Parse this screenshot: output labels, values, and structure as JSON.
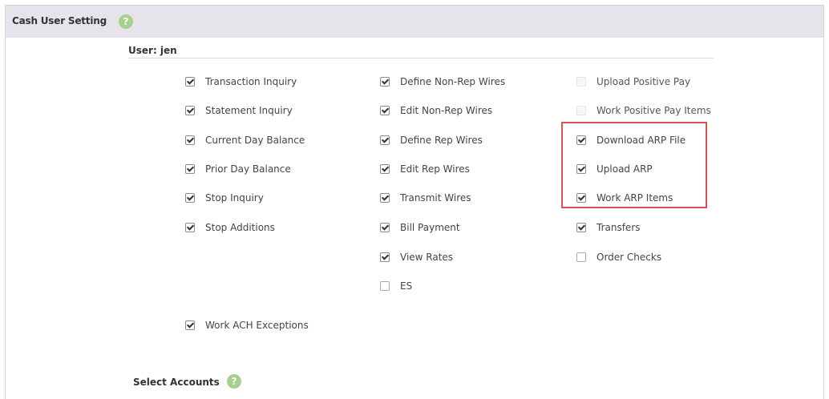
{
  "header": {
    "title": "Cash User Setting",
    "help_icon": "?"
  },
  "user": {
    "label": "User: jen"
  },
  "columns": [
    {
      "items": [
        {
          "label": "Transaction Inquiry",
          "checked": true
        },
        {
          "label": "Statement Inquiry",
          "checked": true
        },
        {
          "label": "Current Day Balance",
          "checked": true
        },
        {
          "label": "Prior Day Balance",
          "checked": true
        },
        {
          "label": "Stop Inquiry",
          "checked": true
        },
        {
          "label": "Stop Additions",
          "checked": true
        },
        {
          "label": "Work ACH Exceptions",
          "checked": true
        }
      ]
    },
    {
      "items": [
        {
          "label": "Define Non-Rep Wires",
          "checked": true
        },
        {
          "label": "Edit Non-Rep Wires",
          "checked": true
        },
        {
          "label": "Define Rep Wires",
          "checked": true
        },
        {
          "label": "Edit Rep Wires",
          "checked": true
        },
        {
          "label": "Transmit Wires",
          "checked": true
        },
        {
          "label": "Bill Payment",
          "checked": true
        },
        {
          "label": "View Rates",
          "checked": true
        },
        {
          "label": "ES",
          "checked": false
        }
      ]
    },
    {
      "items": [
        {
          "label": "Upload Positive Pay",
          "checked": false,
          "disabled": true
        },
        {
          "label": "Work Positive Pay Items",
          "checked": false,
          "disabled": true
        },
        {
          "label": "Download ARP File",
          "checked": true
        },
        {
          "label": "Upload ARP",
          "checked": true
        },
        {
          "label": "Work ARP Items",
          "checked": true
        },
        {
          "label": "Transfers",
          "checked": true
        },
        {
          "label": "Order Checks",
          "checked": false
        }
      ]
    }
  ],
  "select_accounts": {
    "title": "Select Accounts",
    "help_icon": "?"
  },
  "colors": {
    "header_bg": "#e7e3ea",
    "help_icon": "#a8d08d",
    "highlight": "#d9534f"
  }
}
